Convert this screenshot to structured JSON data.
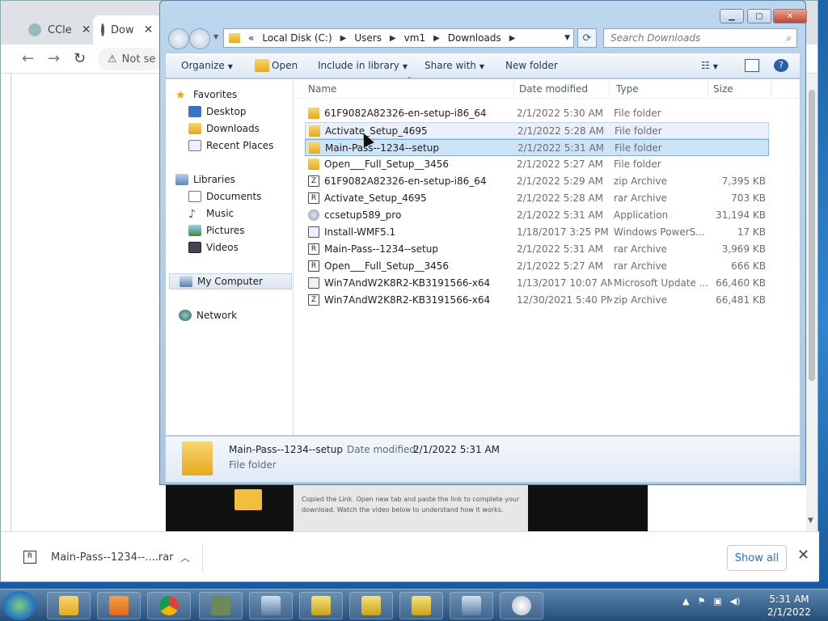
{
  "chrome": {
    "tabs": [
      {
        "label": "CCle"
      },
      {
        "label": "Dow"
      }
    ],
    "omnibox_text": "Not se",
    "download": {
      "filename": "Main-Pass--1234--....rar",
      "show_all": "Show all"
    },
    "page_card_text": "Copied the Link. Open new tab and paste the link to complete your download. Watch the video below to understand how it works."
  },
  "explorer": {
    "address": {
      "prefix": "«",
      "segments": [
        "Local Disk (C:)",
        "Users",
        "vm1",
        "Downloads"
      ]
    },
    "search_placeholder": "Search Downloads",
    "toolbar": {
      "organize": "Organize",
      "open": "Open",
      "include": "Include in library",
      "share": "Share with",
      "new_folder": "New folder"
    },
    "nav": {
      "favorites": "Favorites",
      "desktop": "Desktop",
      "downloads": "Downloads",
      "recent": "Recent Places",
      "libraries": "Libraries",
      "documents": "Documents",
      "music": "Music",
      "pictures": "Pictures",
      "videos": "Videos",
      "computer": "My Computer",
      "network": "Network"
    },
    "columns": {
      "name": "Name",
      "date": "Date modified",
      "type": "Type",
      "size": "Size"
    },
    "files": [
      {
        "name": "61F9082A82326-en-setup-i86_64",
        "date": "2/1/2022 5:30 AM",
        "type": "File folder",
        "size": "",
        "icon": "folder"
      },
      {
        "name": "Activate_Setup_4695",
        "date": "2/1/2022 5:28 AM",
        "type": "File folder",
        "size": "",
        "icon": "folder"
      },
      {
        "name": "Main-Pass--1234--setup",
        "date": "2/1/2022 5:31 AM",
        "type": "File folder",
        "size": "",
        "icon": "folder"
      },
      {
        "name": "Open___Full_Setup__3456",
        "date": "2/1/2022 5:27 AM",
        "type": "File folder",
        "size": "",
        "icon": "folder"
      },
      {
        "name": "61F9082A82326-en-setup-i86_64",
        "date": "2/1/2022 5:29 AM",
        "type": "zip Archive",
        "size": "7,395 KB",
        "icon": "zip"
      },
      {
        "name": "Activate_Setup_4695",
        "date": "2/1/2022 5:28 AM",
        "type": "rar Archive",
        "size": "703 KB",
        "icon": "rar"
      },
      {
        "name": "ccsetup589_pro",
        "date": "2/1/2022 5:31 AM",
        "type": "Application",
        "size": "31,194 KB",
        "icon": "app"
      },
      {
        "name": "Install-WMF5.1",
        "date": "1/18/2017 3:25 PM",
        "type": "Windows PowerS...",
        "size": "17 KB",
        "icon": "ps"
      },
      {
        "name": "Main-Pass--1234--setup",
        "date": "2/1/2022 5:31 AM",
        "type": "rar Archive",
        "size": "3,969 KB",
        "icon": "rar"
      },
      {
        "name": "Open___Full_Setup__3456",
        "date": "2/1/2022 5:27 AM",
        "type": "rar Archive",
        "size": "666 KB",
        "icon": "rar"
      },
      {
        "name": "Win7AndW2K8R2-KB3191566-x64",
        "date": "1/13/2017 10:07 AM",
        "type": "Microsoft Update ...",
        "size": "66,460 KB",
        "icon": "msu"
      },
      {
        "name": "Win7AndW2K8R2-KB3191566-x64",
        "date": "12/30/2021 5:40 PM",
        "type": "zip Archive",
        "size": "66,481 KB",
        "icon": "zip"
      }
    ],
    "details": {
      "name": "Main-Pass--1234--setup",
      "date_label": "Date modified:",
      "date_value": "2/1/2022 5:31 AM",
      "type": "File folder"
    }
  },
  "taskbar": {
    "time": "5:31 AM",
    "date": "2/1/2022"
  }
}
